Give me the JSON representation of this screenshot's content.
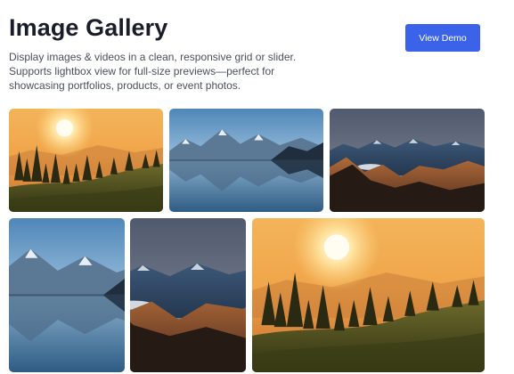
{
  "header": {
    "title": "Image Gallery",
    "description": "Display images & videos in a clean, responsive grid or slider. Supports lightbox view for full-size previews—perfect for showcasing portfolios, products, or event photos.",
    "cta_label": "View Demo"
  },
  "colors": {
    "accent": "#3a63ea",
    "title": "#1a1d29",
    "body_text": "#4a4f5c"
  },
  "gallery": {
    "images": [
      {
        "subject": "sunset-forest-hillside"
      },
      {
        "subject": "mountain-lake-reflection"
      },
      {
        "subject": "mountain-peaks-dusk"
      },
      {
        "subject": "mountain-lake-reflection"
      },
      {
        "subject": "mountain-peaks-dusk"
      },
      {
        "subject": "sunset-forest-hillside"
      }
    ]
  }
}
